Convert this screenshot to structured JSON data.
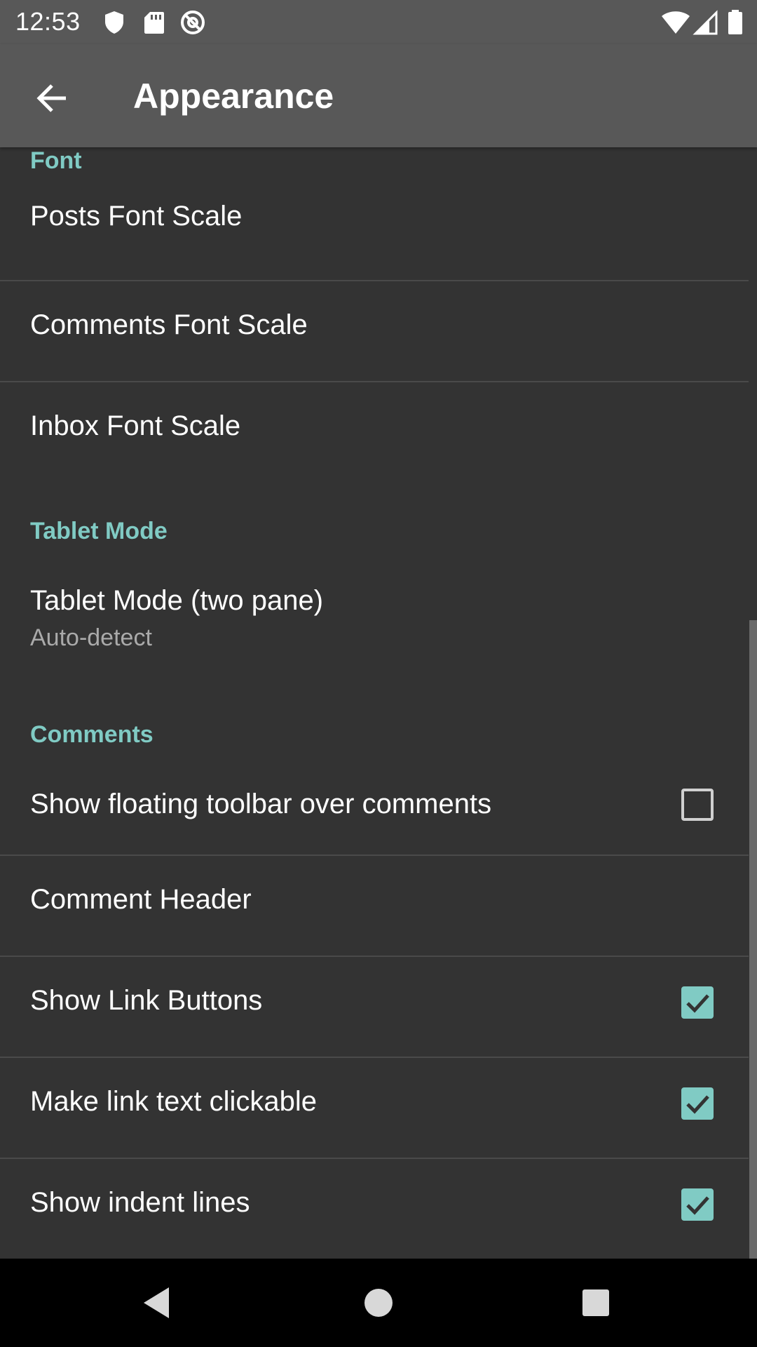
{
  "status_bar": {
    "time": "12:53",
    "left_icons": [
      "shield-icon",
      "sd-card-icon",
      "at-sign-icon"
    ],
    "right_icons": [
      "wifi-icon",
      "cell-signal-icon",
      "battery-icon"
    ]
  },
  "app_bar": {
    "title": "Appearance",
    "back_icon": "arrow-left-icon"
  },
  "sections": {
    "font": {
      "header": "Font",
      "items": [
        {
          "title": "Posts Font Scale"
        },
        {
          "title": "Comments Font Scale"
        },
        {
          "title": "Inbox Font Scale"
        }
      ]
    },
    "tablet_mode": {
      "header": "Tablet Mode",
      "items": [
        {
          "title": "Tablet Mode (two pane)",
          "summary": "Auto-detect"
        }
      ]
    },
    "comments": {
      "header": "Comments",
      "items": [
        {
          "title": "Show floating toolbar over comments",
          "checked": false
        },
        {
          "title": "Comment Header"
        },
        {
          "title": "Show Link Buttons",
          "checked": true
        },
        {
          "title": "Make link text clickable",
          "checked": true
        },
        {
          "title": "Show indent lines",
          "checked": true
        }
      ]
    }
  },
  "nav_bar": {
    "icons": [
      "back-triangle-icon",
      "home-circle-icon",
      "recents-square-icon"
    ]
  },
  "colors": {
    "accent": "#80cbc4",
    "app_bar": "#585858",
    "background": "#333333",
    "nav_bar": "#000000"
  }
}
